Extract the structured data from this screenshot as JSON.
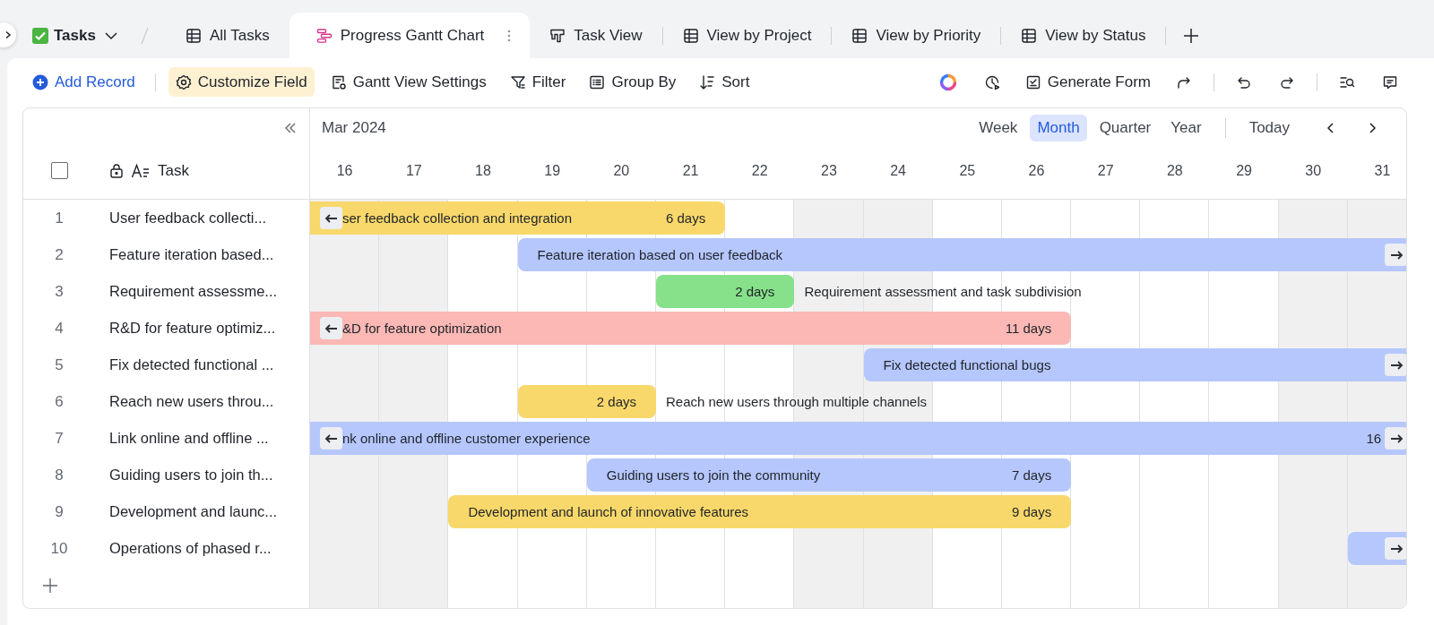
{
  "header": {
    "table_name": "Tasks",
    "tabs": [
      {
        "label": "All Tasks",
        "kind": "grid",
        "selected": false
      },
      {
        "label": "Progress Gantt Chart",
        "kind": "gantt",
        "selected": true
      },
      {
        "label": "Task View",
        "kind": "board",
        "selected": false
      },
      {
        "label": "View by Project",
        "kind": "grid",
        "selected": false
      },
      {
        "label": "View by Priority",
        "kind": "grid",
        "selected": false
      },
      {
        "label": "View by Status",
        "kind": "grid",
        "selected": false
      }
    ]
  },
  "toolbar": {
    "left_groups": [
      [
        {
          "label": "Add Record",
          "kind": "add",
          "highlighted": false
        }
      ],
      [
        {
          "label": "Customize Field",
          "kind": "gear",
          "highlighted": true
        },
        {
          "label": "Gantt View Settings",
          "kind": "settings",
          "highlighted": false
        },
        {
          "label": "Filter",
          "kind": "filter",
          "highlighted": false
        },
        {
          "label": "Group By",
          "kind": "group",
          "highlighted": false
        },
        {
          "label": "Sort",
          "kind": "sort",
          "highlighted": false
        }
      ]
    ],
    "right_groups": [
      [
        {
          "kind": "ring"
        },
        {
          "kind": "clock"
        },
        {
          "kind": "form",
          "label": "Generate Form"
        },
        {
          "kind": "share"
        }
      ],
      [
        {
          "kind": "undo"
        },
        {
          "kind": "redo"
        }
      ],
      [
        {
          "kind": "find"
        },
        {
          "kind": "comment"
        }
      ]
    ]
  },
  "gantt": {
    "month": "Mar 2024",
    "scales": [
      {
        "label": "Week",
        "selected": false
      },
      {
        "label": "Month",
        "selected": true
      },
      {
        "label": "Quarter",
        "selected": false
      },
      {
        "label": "Year",
        "selected": false
      }
    ],
    "today": "Today",
    "days": [
      {
        "label": "16",
        "weekend": true
      },
      {
        "label": "17",
        "weekend": true
      },
      {
        "label": "18",
        "weekend": false
      },
      {
        "label": "19",
        "weekend": false
      },
      {
        "label": "20",
        "weekend": false
      },
      {
        "label": "21",
        "weekend": false
      },
      {
        "label": "22",
        "weekend": false
      },
      {
        "label": "23",
        "weekend": true
      },
      {
        "label": "24",
        "weekend": true
      },
      {
        "label": "25",
        "weekend": false
      },
      {
        "label": "26",
        "weekend": false
      },
      {
        "label": "27",
        "weekend": false
      },
      {
        "label": "28",
        "weekend": false
      },
      {
        "label": "29",
        "weekend": false
      },
      {
        "label": "30",
        "weekend": true
      },
      {
        "label": "31",
        "weekend": true
      }
    ]
  },
  "table": {
    "column": "Task",
    "select_all": {
      "checked": false
    },
    "rows": [
      {
        "number": "1",
        "task": "User feedback collecti...",
        "bar": {
          "color": "#f8d86a",
          "label": "ser feedback collection and integration",
          "duration": "6 days",
          "label_outside": false,
          "clipped_start": true,
          "clipped_end": false
        }
      },
      {
        "number": "2",
        "task": "Feature iteration based...",
        "bar": {
          "color": "#b5c7fd",
          "label": "Feature iteration based on user feedback",
          "label_outside": false,
          "clipped_start": false,
          "clipped_end": true
        }
      },
      {
        "number": "3",
        "task": "Requirement assessme...",
        "bar": {
          "color": "#87e08a",
          "label": "Requirement assessment and task subdivision",
          "duration": "2 days",
          "label_outside": true,
          "clipped_start": false,
          "clipped_end": false
        }
      },
      {
        "number": "4",
        "task": "R&D for feature optimiz...",
        "bar": {
          "color": "#fbb8b5",
          "label": "&D for feature optimization",
          "duration": "11 days",
          "label_outside": false,
          "clipped_start": true,
          "clipped_end": false
        }
      },
      {
        "number": "5",
        "task": "Fix detected functional ...",
        "bar": {
          "color": "#b5c7fd",
          "label": "Fix detected functional bugs",
          "label_outside": false,
          "clipped_start": false,
          "clipped_end": true
        }
      },
      {
        "number": "6",
        "task": "Reach new users throu...",
        "bar": {
          "color": "#f8d86a",
          "label": "Reach new users through multiple channels",
          "duration": "2 days",
          "label_outside": true,
          "clipped_start": false,
          "clipped_end": false
        }
      },
      {
        "number": "7",
        "task": "Link online and offline ...",
        "bar": {
          "color": "#b5c7fd",
          "label": "nk online and offline customer experience",
          "duration": "16",
          "label_outside": false,
          "clipped_start": true,
          "clipped_end": true
        }
      },
      {
        "number": "8",
        "task": "Guiding users to join th...",
        "bar": {
          "color": "#b5c7fd",
          "label": "Guiding users to join the community",
          "duration": "7 days",
          "label_outside": false,
          "clipped_start": false,
          "clipped_end": false
        }
      },
      {
        "number": "9",
        "task": "Development and launc...",
        "bar": {
          "color": "#f8d86a",
          "label": "Development and launch of innovative features",
          "duration": "9 days",
          "label_outside": false,
          "clipped_start": false,
          "clipped_end": false
        }
      },
      {
        "number": "10",
        "task": "Operations of phased r...",
        "bar": {
          "color": "#b5c7fd",
          "clipped_start": false,
          "clipped_end": true
        }
      }
    ]
  }
}
